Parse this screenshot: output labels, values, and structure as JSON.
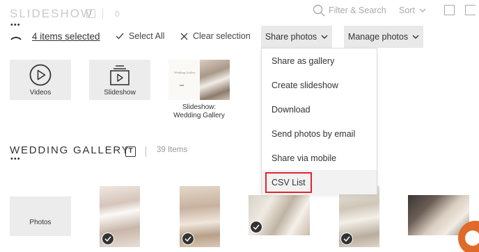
{
  "header": {
    "faded_title": "SLIDESHOW",
    "faded_t": "T",
    "faded_count": "0",
    "search_label": "Filter & Search",
    "sort_label": "Sort"
  },
  "toolbar": {
    "dots": "•••",
    "items_selected": "4 items selected",
    "select_all": "Select All",
    "clear_selection": "Clear selection",
    "share_photos": "Share photos",
    "manage_photos": "Manage photos"
  },
  "tiles": {
    "videos": "Videos",
    "slideshow": "Slideshow",
    "wedding_thumb_text": "Wedding Gallery",
    "wedding_caption_line1": "Slideshow:",
    "wedding_caption_line2": "Wedding Gallery"
  },
  "gallery": {
    "title": "WEDDING GALLERY",
    "t_icon": "T",
    "count": "39 Items",
    "dots": "•••",
    "photos_label": "Photos"
  },
  "share_menu": {
    "items": [
      "Share as gallery",
      "Create slideshow",
      "Download",
      "Send photos by email",
      "Share via mobile",
      "CSV List"
    ],
    "highlight_color": "#e0242d"
  },
  "colors": {
    "accent_chat": "#e06a2a",
    "button_bg": "#e9e9e9",
    "tile_bg": "#ececec"
  }
}
